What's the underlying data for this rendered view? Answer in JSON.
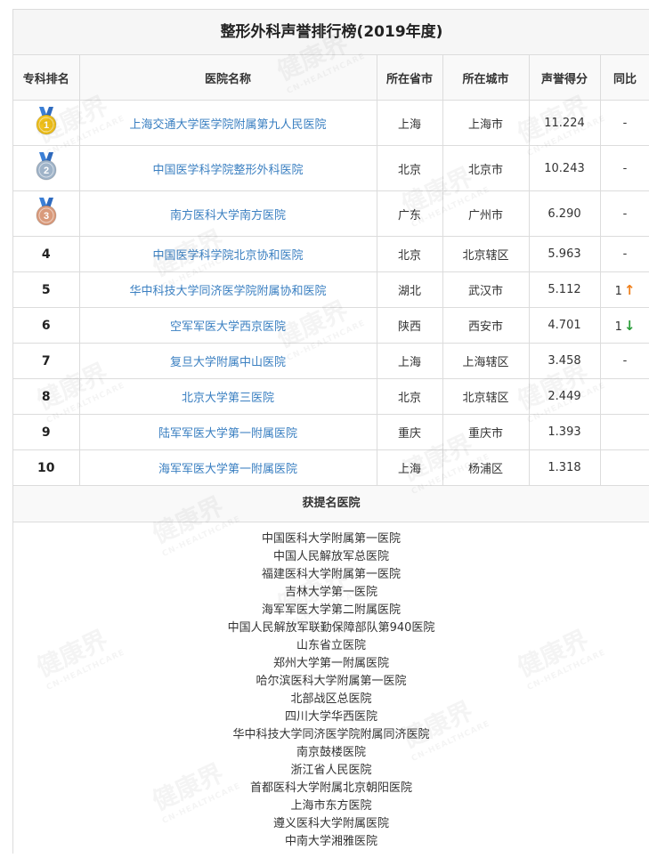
{
  "title": "整形外科声誉排行榜(2019年度)",
  "columns": [
    "专科排名",
    "医院名称",
    "所在省市",
    "所在城市",
    "声誉得分",
    "同比"
  ],
  "rows": [
    {
      "rank": "",
      "medal": "1",
      "medal_type": "gold",
      "name": "上海交通大学医学院附属第九人民医院",
      "province": "上海",
      "city": "上海市",
      "score": "11.224",
      "change": "-",
      "arrow": ""
    },
    {
      "rank": "",
      "medal": "2",
      "medal_type": "silver",
      "name": "中国医学科学院整形外科医院",
      "province": "北京",
      "city": "北京市",
      "score": "10.243",
      "change": "-",
      "arrow": ""
    },
    {
      "rank": "",
      "medal": "3",
      "medal_type": "bronze",
      "name": "南方医科大学南方医院",
      "province": "广东",
      "city": "广州市",
      "score": "6.290",
      "change": "-",
      "arrow": ""
    },
    {
      "rank": "4",
      "medal": "",
      "medal_type": "",
      "name": "中国医学科学院北京协和医院",
      "province": "北京",
      "city": "北京辖区",
      "score": "5.963",
      "change": "-",
      "arrow": ""
    },
    {
      "rank": "5",
      "medal": "",
      "medal_type": "",
      "name": "华中科技大学同济医学院附属协和医院",
      "province": "湖北",
      "city": "武汉市",
      "score": "5.112",
      "change": "1",
      "arrow": "↑"
    },
    {
      "rank": "6",
      "medal": "",
      "medal_type": "",
      "name": "空军军医大学西京医院",
      "province": "陕西",
      "city": "西安市",
      "score": "4.701",
      "change": "1",
      "arrow": "↓"
    },
    {
      "rank": "7",
      "medal": "",
      "medal_type": "",
      "name": "复旦大学附属中山医院",
      "province": "上海",
      "city": "上海辖区",
      "score": "3.458",
      "change": "-",
      "arrow": ""
    },
    {
      "rank": "8",
      "medal": "",
      "medal_type": "",
      "name": "北京大学第三医院",
      "province": "北京",
      "city": "北京辖区",
      "score": "2.449",
      "change": "",
      "arrow": ""
    },
    {
      "rank": "9",
      "medal": "",
      "medal_type": "",
      "name": "陆军军医大学第一附属医院",
      "province": "重庆",
      "city": "重庆市",
      "score": "1.393",
      "change": "",
      "arrow": ""
    },
    {
      "rank": "10",
      "medal": "",
      "medal_type": "",
      "name": "海军军医大学第一附属医院",
      "province": "上海",
      "city": "杨浦区",
      "score": "1.318",
      "change": "",
      "arrow": ""
    }
  ],
  "nominees_title": "获提名医院",
  "nominees": [
    "中国医科大学附属第一医院",
    "中国人民解放军总医院",
    "福建医科大学附属第一医院",
    "吉林大学第一医院",
    "海军军医大学第二附属医院",
    "中国人民解放军联勤保障部队第940医院",
    "山东省立医院",
    "郑州大学第一附属医院",
    "哈尔滨医科大学附属第一医院",
    "北部战区总医院",
    "四川大学华西医院",
    "华中科技大学同济医学院附属同济医院",
    "南京鼓楼医院",
    "浙江省人民医院",
    "首都医科大学附属北京朝阳医院",
    "上海市东方医院",
    "遵义医科大学附属医院",
    "中南大学湘雅医院"
  ],
  "watermark": {
    "main": "健康界",
    "sub": "CN-HEALTHCARE"
  },
  "colors": {
    "link": "#3a7fc1",
    "up": "#ef7f1a",
    "down": "#2a9d3a",
    "gold": "#f2c21b",
    "silver": "#9fb3c8",
    "bronze": "#d99a7b"
  }
}
